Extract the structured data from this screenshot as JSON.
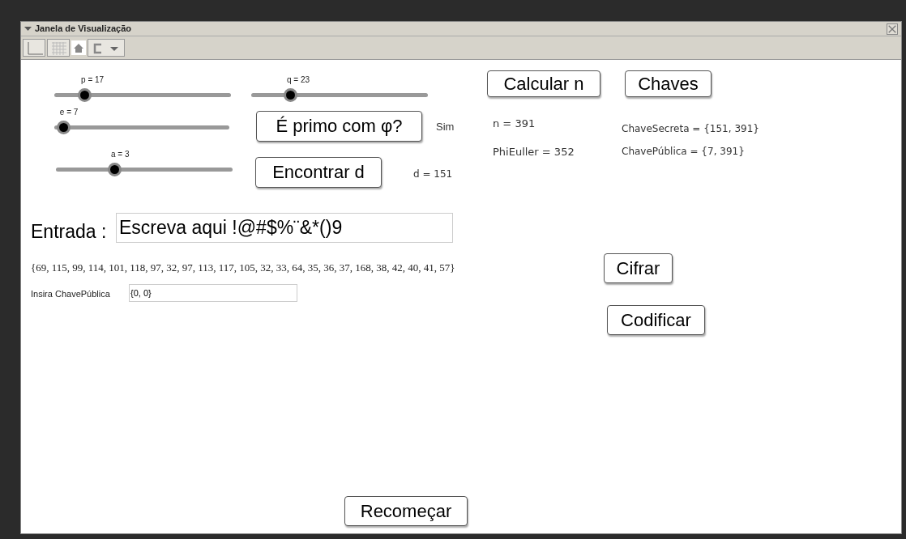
{
  "window": {
    "title": "Janela de Visualização",
    "expanded": true
  },
  "sliders": [
    {
      "label": "p = 17",
      "level": 0.17
    },
    {
      "label": "q = 23",
      "level": 0.22
    },
    {
      "label": "e = 7",
      "level": 0.05
    },
    {
      "label": "a = 3",
      "level": 0.33
    }
  ],
  "buttons": [
    "Calcular n",
    "Chaves",
    "É primo com φ?",
    "Encontrar d",
    "Cifrar",
    "Codificar",
    "Recomeçar"
  ],
  "texts": [
    "Sim",
    "n = 391",
    "PhiEuller = 352",
    "ChaveSecreta = {151, 391}",
    "ChavePública = {7, 391}",
    "d = 151"
  ],
  "entrada": {
    "label": "Entrada :",
    "value": "Escreva aqui !@#$%¨&*()9"
  },
  "codes": "{69, 115, 99, 114, 101, 118, 97, 32, 97, 113, 117, 105, 32, 33, 64, 35, 36, 37, 168, 38, 42, 40, 41, 57}",
  "public_key_input": {
    "label": "Insira ChavePública",
    "value": "{0, 0}"
  }
}
